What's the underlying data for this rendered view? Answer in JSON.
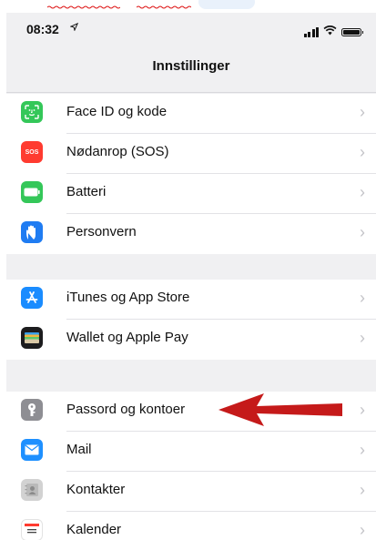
{
  "colors": {
    "faceid": "#34c759",
    "sos": "#ff3b30",
    "battery": "#34c759",
    "privacy": "#1f7cf2",
    "appstore": "#1a8cff",
    "wallet": "#1c1c1e",
    "passwords": "#8e8e93",
    "mail": "#1e90ff",
    "contacts": "#c9c9c9",
    "calendar": "#ffffff",
    "arrow": "#c51a1a"
  },
  "status": {
    "time": "08:32"
  },
  "nav": {
    "title": "Innstillinger"
  },
  "groups": [
    {
      "items": [
        {
          "label": "Face ID og kode",
          "icon": "face-id-icon"
        },
        {
          "label": "Nødanrop (SOS)",
          "icon": "sos-icon",
          "icon_text": "SOS"
        },
        {
          "label": "Batteri",
          "icon": "battery-icon"
        },
        {
          "label": "Personvern",
          "icon": "hand-icon"
        }
      ]
    },
    {
      "items": [
        {
          "label": "iTunes og App Store",
          "icon": "app-store-icon"
        },
        {
          "label": "Wallet og Apple Pay",
          "icon": "wallet-icon"
        }
      ]
    },
    {
      "items": [
        {
          "label": "Passord og kontoer",
          "icon": "key-icon"
        },
        {
          "label": "Mail",
          "icon": "mail-icon"
        },
        {
          "label": "Kontakter",
          "icon": "contacts-icon"
        },
        {
          "label": "Kalender",
          "icon": "calendar-icon"
        }
      ]
    }
  ]
}
